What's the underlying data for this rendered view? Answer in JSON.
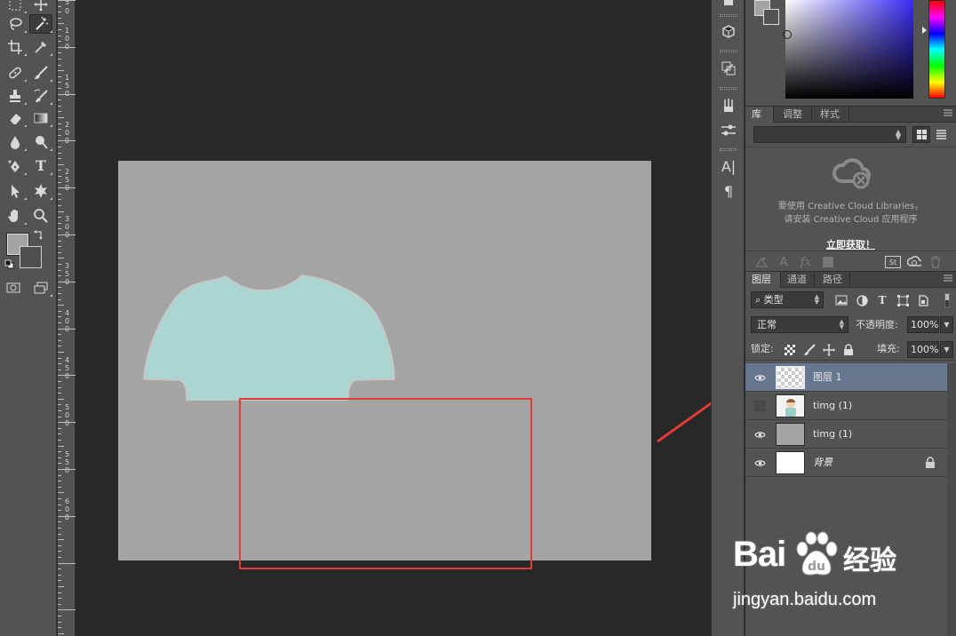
{
  "toolbar": {
    "tools": [
      "rectangular-marquee",
      "move",
      "lasso",
      "magic-wand",
      "crop",
      "eyedropper",
      "spot-healing-brush",
      "brush",
      "clone-stamp",
      "history-brush",
      "eraser",
      "gradient",
      "blur",
      "dodge",
      "pen",
      "type",
      "path-selection",
      "custom-shape",
      "hand",
      "zoom",
      "quick-mask",
      "screen-mode"
    ],
    "active_tool": "magic-wand",
    "type_glyph": "T",
    "foreground_color": "#a3a3a3",
    "background_color": "#4e4e4e"
  },
  "ruler": {
    "labels": [
      "1\n0\n0",
      "1\n5\n0",
      "2\n0\n0",
      "2\n5\n0",
      "3\n0\n0",
      "3\n5\n0",
      "4\n0\n0",
      "4\n5\n0",
      "5\n0\n0"
    ],
    "top_labels": [
      "5",
      "0",
      "1\n0\n0",
      "1\n5\n0",
      "2\n0\n0",
      "2\n5\n0",
      "3\n0\n0",
      "3\n5\n0",
      "4\n0\n0",
      "4\n5\n0",
      "5\n0\n0"
    ]
  },
  "canvas": {
    "background": "#a4a4a4",
    "shirt_color": "#a6d3cd",
    "highlight_color": "#e03a3a",
    "arrow_color": "#e03a3a"
  },
  "dock": {
    "text_glyph": "A|",
    "paragraph_glyph": "¶"
  },
  "color_panel": {
    "foreground": "#a3a3a3",
    "background": "#535353"
  },
  "libraries_panel": {
    "tabs": [
      "库",
      "调整",
      "样式"
    ],
    "active_tab": "库",
    "message_line1": "要使用 Creative Cloud Libraries，",
    "message_line2": "请安装 Creative Cloud 应用程序",
    "get_link": "立即获取！",
    "footer_icons": [
      "add-graphic-icon",
      "add-char-style-icon",
      "add-layer-style-icon",
      "add-color-icon",
      "stock-icon",
      "sync-icon",
      "trash-icon"
    ],
    "footer_text_A": "A",
    "footer_text_fx": "fx",
    "footer_text_st": "St"
  },
  "layers_panel": {
    "tabs": [
      "图层",
      "通道",
      "路径"
    ],
    "active_tab": "图层",
    "kind_filter": "类型",
    "blend_mode": "正常",
    "opacity_label": "不透明度:",
    "opacity_value": "100%",
    "lock_label": "锁定:",
    "fill_label": "填充:",
    "fill_value": "100%",
    "type_filter_glyph": "T",
    "layers": [
      {
        "name": "图层 1",
        "visible": true,
        "selected": true,
        "thumb": "checker"
      },
      {
        "name": "timg (1)",
        "visible": false,
        "selected": false,
        "thumb": "cartoon"
      },
      {
        "name": "timg (1)",
        "visible": true,
        "selected": false,
        "thumb": "gray"
      },
      {
        "name": "背景",
        "visible": true,
        "selected": false,
        "thumb": "white",
        "locked": true
      }
    ]
  },
  "watermark": {
    "brand": "Bai",
    "brand_suffix": "",
    "cn_text": "经验",
    "url": "jingyan.baidu.com"
  }
}
